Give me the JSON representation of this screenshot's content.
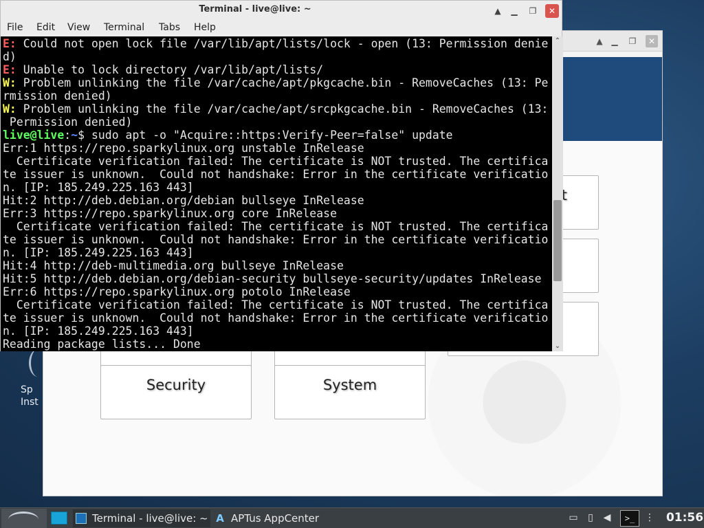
{
  "desktop": {
    "icon_label_line1": "Sp",
    "icon_label_line2": "Inst"
  },
  "aptus": {
    "title": "APTus AppCenter",
    "categories": [
      {
        "label": "t"
      },
      {
        "label": "Security"
      },
      {
        "label": "System"
      }
    ]
  },
  "terminal": {
    "title": "Terminal - live@live: ~",
    "menu": [
      "File",
      "Edit",
      "View",
      "Terminal",
      "Tabs",
      "Help"
    ],
    "lines": [
      {
        "prefix": "E:",
        "type": "err",
        "text": " Could not open lock file /var/lib/apt/lists/lock - open (13: Permission denie"
      },
      {
        "prefix": "",
        "type": "plain",
        "text": "d)"
      },
      {
        "prefix": "E:",
        "type": "err",
        "text": " Unable to lock directory /var/lib/apt/lists/"
      },
      {
        "prefix": "W:",
        "type": "warn",
        "text": " Problem unlinking the file /var/cache/apt/pkgcache.bin - RemoveCaches (13: Pe"
      },
      {
        "prefix": "",
        "type": "plain",
        "text": "rmission denied)"
      },
      {
        "prefix": "W:",
        "type": "warn",
        "text": " Problem unlinking the file /var/cache/apt/srcpkgcache.bin - RemoveCaches (13:"
      },
      {
        "prefix": "",
        "type": "plain",
        "text": " Permission denied)"
      },
      {
        "prefix": "",
        "type": "prompt",
        "user": "live@live",
        "path": "~",
        "text": "$ sudo apt -o \"Acquire::https:Verify-Peer=false\" update"
      },
      {
        "prefix": "",
        "type": "plain",
        "text": "Err:1 https://repo.sparkylinux.org unstable InRelease"
      },
      {
        "prefix": "",
        "type": "plain",
        "text": "  Certificate verification failed: The certificate is NOT trusted. The certifica"
      },
      {
        "prefix": "",
        "type": "plain",
        "text": "te issuer is unknown.  Could not handshake: Error in the certificate verificatio"
      },
      {
        "prefix": "",
        "type": "plain",
        "text": "n. [IP: 185.249.225.163 443]"
      },
      {
        "prefix": "",
        "type": "plain",
        "text": "Hit:2 http://deb.debian.org/debian bullseye InRelease"
      },
      {
        "prefix": "",
        "type": "plain",
        "text": "Err:3 https://repo.sparkylinux.org core InRelease"
      },
      {
        "prefix": "",
        "type": "plain",
        "text": "  Certificate verification failed: The certificate is NOT trusted. The certifica"
      },
      {
        "prefix": "",
        "type": "plain",
        "text": "te issuer is unknown.  Could not handshake: Error in the certificate verificatio"
      },
      {
        "prefix": "",
        "type": "plain",
        "text": "n. [IP: 185.249.225.163 443]"
      },
      {
        "prefix": "",
        "type": "plain",
        "text": "Hit:4 http://deb-multimedia.org bullseye InRelease"
      },
      {
        "prefix": "",
        "type": "plain",
        "text": "Hit:5 http://deb.debian.org/debian-security bullseye-security/updates InRelease"
      },
      {
        "prefix": "",
        "type": "plain",
        "text": "Err:6 https://repo.sparkylinux.org potolo InRelease"
      },
      {
        "prefix": "",
        "type": "plain",
        "text": "  Certificate verification failed: The certificate is NOT trusted. The certifica"
      },
      {
        "prefix": "",
        "type": "plain",
        "text": "te issuer is unknown.  Could not handshake: Error in the certificate verificatio"
      },
      {
        "prefix": "",
        "type": "plain",
        "text": "n. [IP: 185.249.225.163 443]"
      },
      {
        "prefix": "",
        "type": "plain",
        "text": "Reading package lists... Done"
      }
    ]
  },
  "taskbar": {
    "tasks": [
      {
        "label": "Terminal - live@live: ~",
        "icon": "terminal-icon"
      },
      {
        "label": "APTus AppCenter",
        "icon": "aptus-icon"
      }
    ],
    "clock": "01:56"
  },
  "colors": {
    "error": "#ff5f5f",
    "warning": "#ffff55",
    "prompt_user": "#5fff5f",
    "prompt_path": "#5c87ff",
    "close_button": "#d9534f",
    "show_desktop": "#19a4d9"
  }
}
